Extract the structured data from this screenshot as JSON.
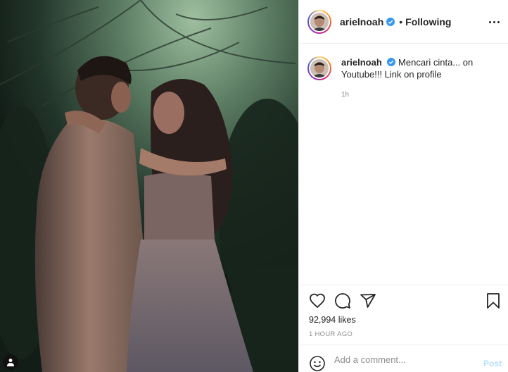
{
  "post": {
    "username": "arielnoah",
    "separator": "•",
    "follow_status": "Following",
    "caption_text": "Mencari cinta... on Youtube!!! Link on profile",
    "caption_time": "1h",
    "likes": "92,994 likes",
    "posted_ago": "1 HOUR AGO"
  },
  "comment": {
    "placeholder": "Add a comment...",
    "post_label": "Post"
  },
  "colors": {
    "verified": "#3897f0",
    "post_button": "#b2dffc",
    "muted_text": "#8e8e8e"
  },
  "icons": {
    "header": [
      "verified-badge-icon",
      "more-options-icon"
    ],
    "actions": [
      "heart-icon",
      "comment-icon",
      "share-icon",
      "bookmark-icon"
    ],
    "comment": [
      "emoji-icon"
    ],
    "photo": [
      "user-tag-icon"
    ]
  }
}
